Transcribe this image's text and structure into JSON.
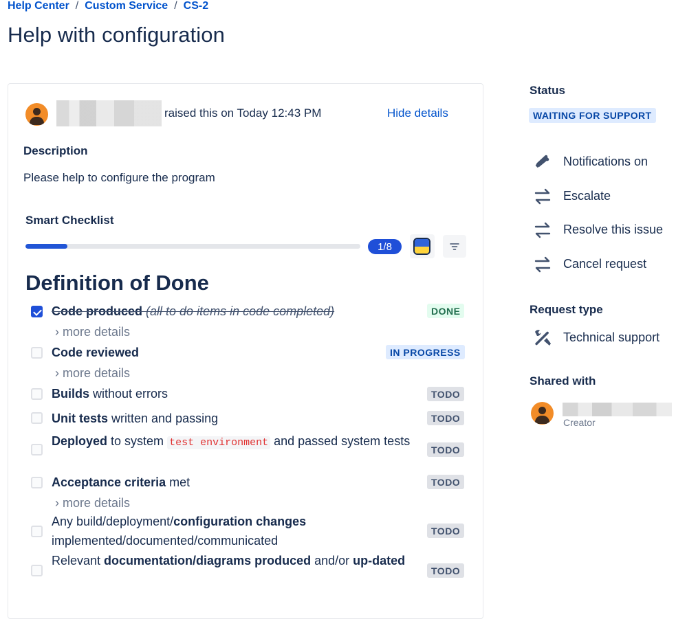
{
  "breadcrumb": {
    "items": [
      "Help Center",
      "Custom Service",
      "CS-2"
    ],
    "separator": "/"
  },
  "page": {
    "title": "Help with configuration"
  },
  "request": {
    "raised_text": "raised this on Today 12:43 PM",
    "hide_details": "Hide details",
    "description_label": "Description",
    "description": "Please help to configure the program"
  },
  "checklist": {
    "label": "Smart Checklist",
    "progress_fraction": 0.125,
    "count": "1/8",
    "heading": "Definition of Done",
    "more_details": "› more details",
    "items": [
      {
        "status": "DONE"
      },
      {
        "bold": "Code reviewed",
        "status": "IN PROGRESS"
      },
      {
        "bold": "Builds",
        "rest": " without errors",
        "status": "TODO"
      },
      {
        "bold": "Unit tests",
        "rest": " written and passing",
        "status": "TODO"
      },
      {
        "bold": "Deployed",
        "rest1": " to system ",
        "code": "test environment",
        "rest2": " and passed system tests",
        "status": "TODO"
      },
      {
        "bold": "Acceptance criteria",
        "rest": " met",
        "status": "TODO"
      },
      {
        "pre": "Any build/deployment/",
        "bold": "configuration changes",
        "rest": " implemented/documented/communicated",
        "status": "TODO"
      },
      {
        "pre": "Relevant ",
        "bold": "documentation/diagrams produced",
        "mid": " and/or ",
        "bold2": "up-dated",
        "status": "TODO"
      }
    ],
    "item0": {
      "bold": "Code produced",
      "i1": " (all ",
      "strike_inner": "to  do",
      "i2": " items in code completed)"
    }
  },
  "sidebar": {
    "status_label": "Status",
    "status": "WAITING FOR SUPPORT",
    "actions": [
      "Notifications on",
      "Escalate",
      "Resolve this issue",
      "Cancel request"
    ],
    "request_type_label": "Request type",
    "request_type": "Technical support",
    "shared_label": "Shared with",
    "shared_role": "Creator"
  },
  "colors": {
    "brand_blue": "#0052cc",
    "progress_fill": "#2155d6",
    "done_green": "#216e4e",
    "code_red": "#e02f2f"
  },
  "icons": [
    "user-avatar-icon",
    "flag-icon",
    "filter-icon",
    "checkbox-icon",
    "megaphone-icon",
    "swap-arrows-icon",
    "tools-icon"
  ]
}
